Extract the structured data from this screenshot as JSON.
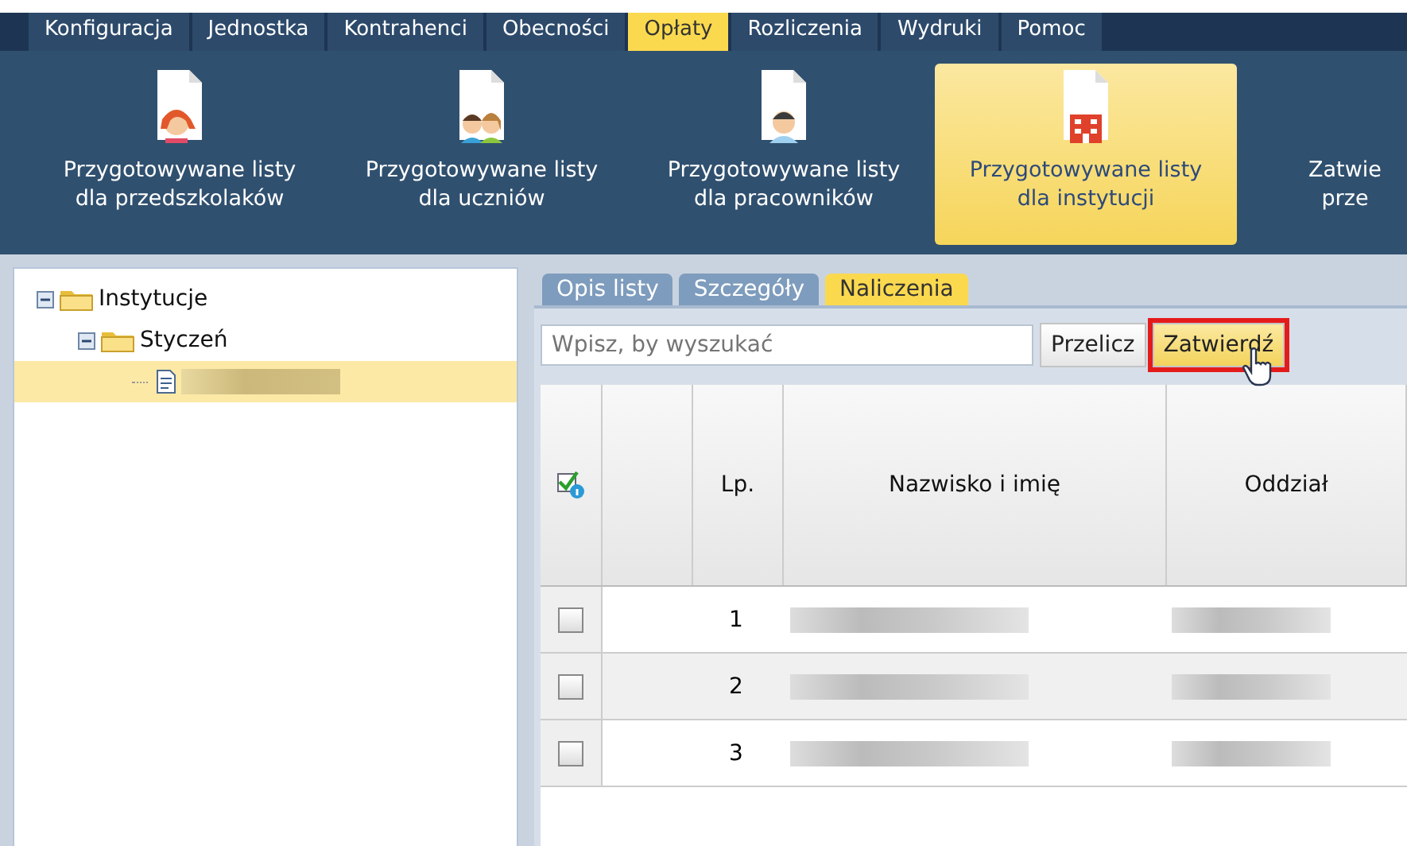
{
  "menu": [
    {
      "label": "Konfiguracja",
      "selected": false
    },
    {
      "label": "Jednostka",
      "selected": false
    },
    {
      "label": "Kontrahenci",
      "selected": false
    },
    {
      "label": "Obecności",
      "selected": false
    },
    {
      "label": "Opłaty",
      "selected": true
    },
    {
      "label": "Rozliczenia",
      "selected": false
    },
    {
      "label": "Wydruki",
      "selected": false
    },
    {
      "label": "Pomoc",
      "selected": false
    }
  ],
  "ribbon": [
    {
      "kind": "girl",
      "label": [
        "Przygotowywane listy",
        "dla przedszkolaków"
      ],
      "selected": false
    },
    {
      "kind": "kids",
      "label": [
        "Przygotowywane listy",
        "dla uczniów"
      ],
      "selected": false
    },
    {
      "kind": "man",
      "label": [
        "Przygotowywane listy",
        "dla pracowników"
      ],
      "selected": false
    },
    {
      "kind": "building",
      "label": [
        "Przygotowywane listy",
        "dla instytucji"
      ],
      "selected": true
    },
    {
      "kind": "cut",
      "label": [
        "Zatwie",
        "prze"
      ],
      "selected": false
    }
  ],
  "tree": [
    {
      "label": "Instytucje",
      "expanded": true,
      "selected": false,
      "children": [
        {
          "label": "Styczeń",
          "expanded": true,
          "selected": false,
          "children": [
            {
              "kind": "document",
              "selected": true
            }
          ]
        }
      ]
    }
  ],
  "tabs": [
    {
      "label": "Opis listy",
      "selected": false
    },
    {
      "label": "Szczegóły",
      "selected": false
    },
    {
      "label": "Naliczenia",
      "selected": true
    }
  ],
  "search": {
    "placeholder": "Wpisz, by wyszukać"
  },
  "buttons": [
    {
      "label": "Przelicz",
      "highlighted": false
    },
    {
      "label": "Zatwierdź",
      "highlighted": true
    }
  ],
  "table": {
    "columns": [
      "Lp.",
      "Nazwisko i imię",
      "Oddział"
    ],
    "rows": [
      {
        "lp": "1",
        "checked": false
      },
      {
        "lp": "2",
        "checked": false
      },
      {
        "lp": "3",
        "checked": false
      }
    ]
  }
}
